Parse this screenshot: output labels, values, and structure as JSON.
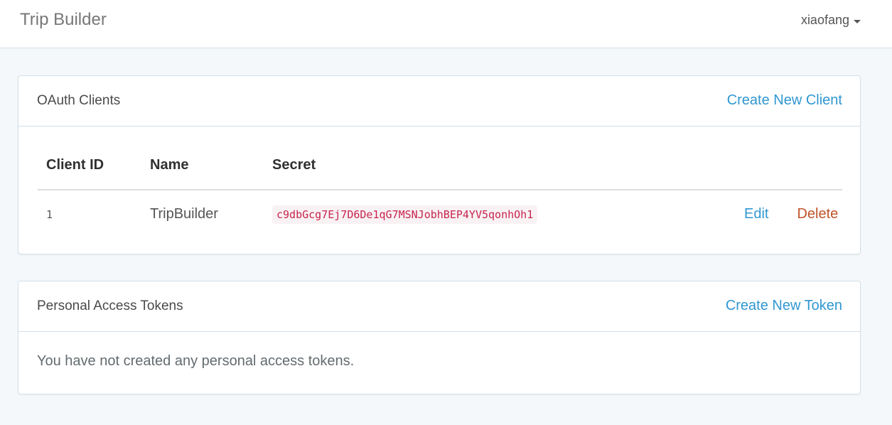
{
  "navbar": {
    "brand": "Trip Builder",
    "user": "xiaofang"
  },
  "clients_panel": {
    "title": "OAuth Clients",
    "create_link": "Create New Client",
    "columns": [
      "Client ID",
      "Name",
      "Secret"
    ],
    "rows": [
      {
        "id": "1",
        "name": "TripBuilder",
        "secret": "c9dbGcg7Ej7D6De1qG7MSNJobhBEP4YV5qonhOh1",
        "edit_label": "Edit",
        "delete_label": "Delete"
      }
    ]
  },
  "tokens_panel": {
    "title": "Personal Access Tokens",
    "create_link": "Create New Token",
    "empty_message": "You have not created any personal access tokens."
  },
  "colors": {
    "link": "#3097d1",
    "danger": "#bf5329",
    "code": "#c7254e",
    "border": "#d3e0e9",
    "background": "#f5f8fa"
  }
}
